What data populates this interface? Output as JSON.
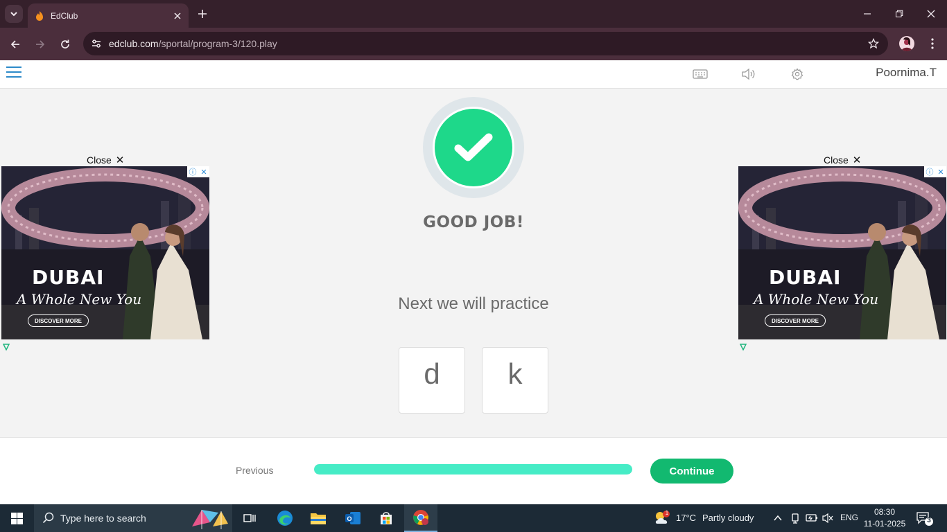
{
  "browser": {
    "tab_title": "EdClub",
    "url_host": "edclub.com",
    "url_path": "/sportal/program-3/120.play"
  },
  "header": {
    "username": "Poornima.T",
    "icons": [
      "keyboard-icon",
      "speaker-icon",
      "gear-icon"
    ]
  },
  "result": {
    "title": "GOOD JOB!",
    "next_text": "Next we will practice",
    "keys": [
      "d",
      "k"
    ]
  },
  "ads": {
    "close_label": "Close",
    "title": "DUBAI",
    "tagline": "A Whole New You",
    "button": "DISCOVER MORE"
  },
  "footer": {
    "previous_label": "Previous",
    "continue_label": "Continue",
    "progress_fraction": 1.0
  },
  "taskbar": {
    "search_placeholder": "Type here to search",
    "weather_temp": "17°C",
    "weather_desc": "Partly cloudy",
    "weather_badge": "1",
    "language": "ENG",
    "time": "08:30",
    "date": "11-01-2025",
    "notification_count": "3"
  }
}
